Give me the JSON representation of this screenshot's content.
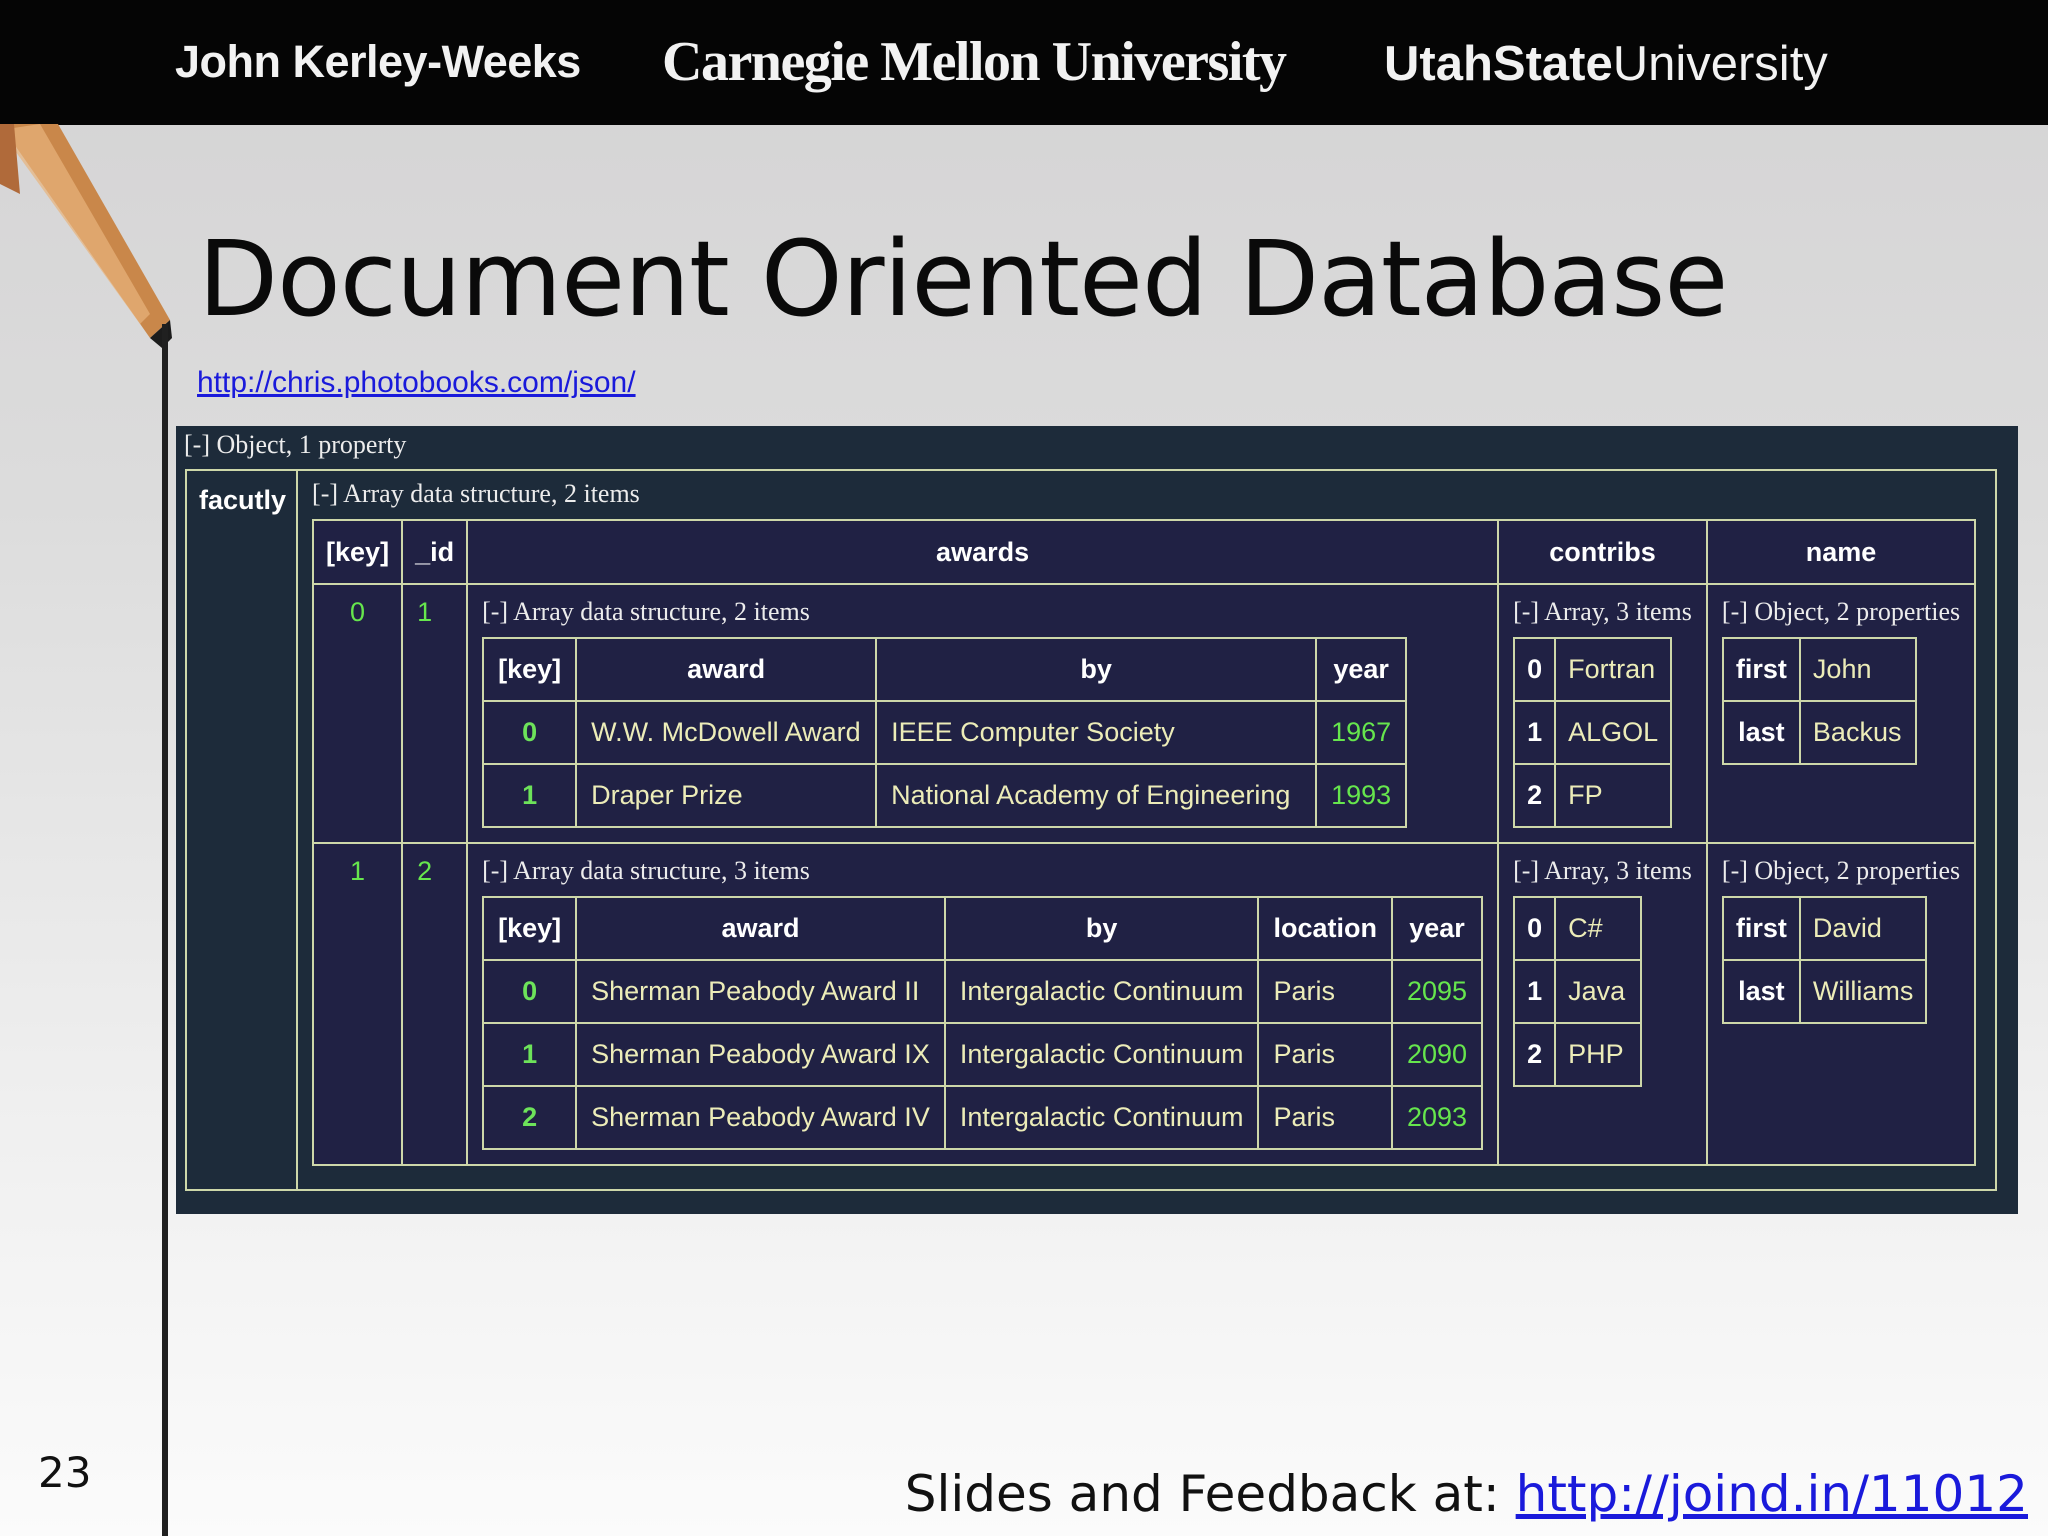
{
  "header": {
    "presenter": "John Kerley-Weeks",
    "cmu": "Carnegie Mellon University",
    "usu_bold": "UtahState",
    "usu_regular": "University"
  },
  "slide": {
    "title": "Document Oriented Database",
    "source_link": "http://chris.photobooks.com/json/",
    "number": "23",
    "footer_text": "Slides and Feedback at: ",
    "footer_link": "http://joind.in/11012"
  },
  "viewer": {
    "root_label": "[-] Object, 1 property",
    "faculty_key": "facutly",
    "faculty_label": "[-] Array data structure, 2 items",
    "headers": [
      "[key]",
      "_id",
      "awards",
      "contribs",
      "name"
    ],
    "rows": [
      {
        "key": "0",
        "id": "1",
        "awards_label": "[-] Array data structure, 2 items",
        "awards_headers": [
          "[key]",
          "award",
          "by",
          "year"
        ],
        "awards": [
          {
            "key": "0",
            "award": "W.W. McDowell Award",
            "by": "IEEE Computer Society",
            "year": "1967"
          },
          {
            "key": "1",
            "award": "Draper Prize",
            "by": "National Academy of Engineering",
            "year": "1993"
          }
        ],
        "contribs_label": "[-] Array, 3 items",
        "contribs": [
          {
            "key": "0",
            "value": "Fortran"
          },
          {
            "key": "1",
            "value": "ALGOL"
          },
          {
            "key": "2",
            "value": "FP"
          }
        ],
        "name_label": "[-] Object, 2 properties",
        "name": [
          {
            "key": "first",
            "value": "John"
          },
          {
            "key": "last",
            "value": "Backus"
          }
        ]
      },
      {
        "key": "1",
        "id": "2",
        "awards_label": "[-] Array data structure, 3 items",
        "awards_headers": [
          "[key]",
          "award",
          "by",
          "location",
          "year"
        ],
        "awards": [
          {
            "key": "0",
            "award": "Sherman Peabody Award II",
            "by": "Intergalactic Continuum",
            "location": "Paris",
            "year": "2095"
          },
          {
            "key": "1",
            "award": "Sherman Peabody Award IX",
            "by": "Intergalactic Continuum",
            "location": "Paris",
            "year": "2090"
          },
          {
            "key": "2",
            "award": "Sherman Peabody Award IV",
            "by": "Intergalactic Continuum",
            "location": "Paris",
            "year": "2093"
          }
        ],
        "contribs_label": "[-] Array, 3 items",
        "contribs": [
          {
            "key": "0",
            "value": "C#"
          },
          {
            "key": "1",
            "value": "Java"
          },
          {
            "key": "2",
            "value": "PHP"
          }
        ],
        "name_label": "[-] Object, 2 properties",
        "name": [
          {
            "key": "first",
            "value": "David"
          },
          {
            "key": "last",
            "value": "Williams"
          }
        ]
      }
    ]
  },
  "colors": {
    "header_bg": "#050505",
    "viewer_bg": "#1d2b3a",
    "table_bg": "#202144",
    "border": "#cdd7a9",
    "number_green": "#66e64d",
    "text_cream": "#ececb8",
    "link_blue": "#1a1adb"
  },
  "icons": {
    "decoration": "pencil-icon"
  }
}
